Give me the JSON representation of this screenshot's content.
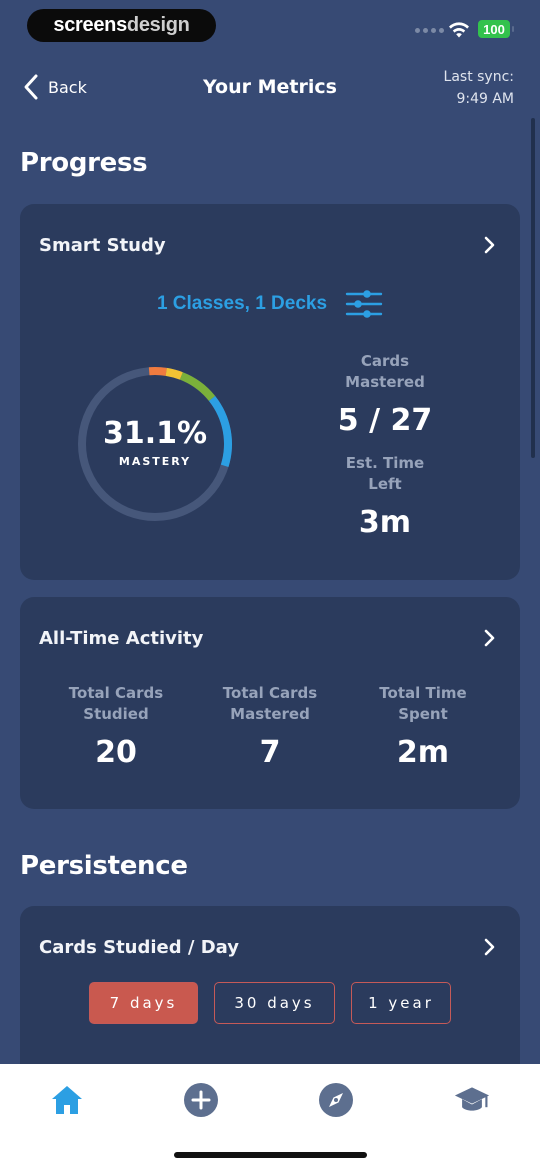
{
  "status_bar": {
    "brand_part1": "screens",
    "brand_part2": "design",
    "battery": "100"
  },
  "header": {
    "back_label": "Back",
    "title": "Your Metrics",
    "sync_line1": "Last sync:",
    "sync_line2": "9:49 AM"
  },
  "sections": {
    "progress": "Progress",
    "persistence": "Persistence"
  },
  "smart_study": {
    "title": "Smart Study",
    "filter_label": "1 Classes, 1 Decks",
    "mastery_value": "31.1%",
    "mastery_label": "MASTERY",
    "mastery_fraction": 0.311,
    "cards_mastered_label_1": "Cards",
    "cards_mastered_label_2": "Mastered",
    "cards_mastered_value": "5 / 27",
    "time_left_label_1": "Est. Time",
    "time_left_label_2": "Left",
    "time_left_value": "3m",
    "ring_colors": [
      "#f07b3f",
      "#f2c234",
      "#7bb03a",
      "#2c9fe3"
    ]
  },
  "all_time": {
    "title": "All-Time Activity",
    "stats": [
      {
        "label_1": "Total Cards",
        "label_2": "Studied",
        "value": "20"
      },
      {
        "label_1": "Total Cards",
        "label_2": "Mastered",
        "value": "7"
      },
      {
        "label_1": "Total Time",
        "label_2": "Spent",
        "value": "2m"
      }
    ]
  },
  "cards_per_day": {
    "title": "Cards Studied / Day",
    "ranges": [
      "7 days",
      "30 days",
      "1 year"
    ],
    "selected_range": "7 days"
  },
  "tab_bar": {
    "items": [
      "home-icon",
      "add-icon",
      "explore-icon",
      "classes-icon"
    ],
    "active": "home-icon",
    "active_color": "#2c9fe3",
    "inactive_color": "#5d6f8f"
  }
}
